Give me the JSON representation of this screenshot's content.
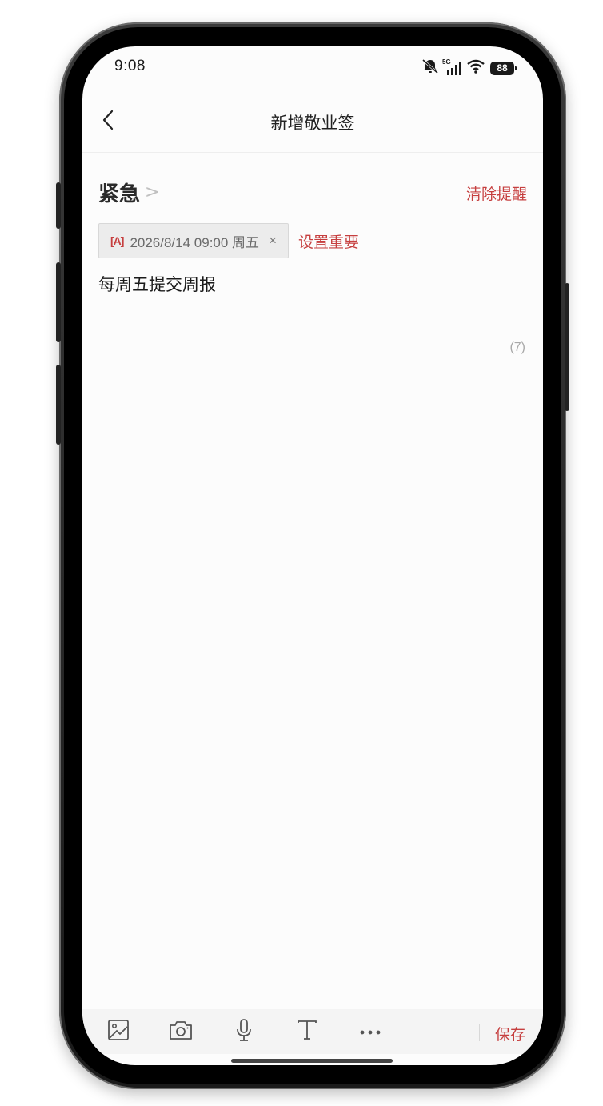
{
  "status_bar": {
    "time": "9:08",
    "battery": "88",
    "network": "5G"
  },
  "nav": {
    "title": "新增敬业签",
    "back_icon": "chevron-left-icon"
  },
  "priority": {
    "label": "紧急",
    "chevron": ">",
    "clear_reminder_label": "清除提醒"
  },
  "reminder": {
    "icon_text": "[A]",
    "datetime": "2026/8/14 09:00 周五",
    "close_glyph": "×",
    "set_important_label": "设置重要"
  },
  "note": {
    "content": "每周五提交周报",
    "char_count": "(7)"
  },
  "toolbar": {
    "save_label": "保存"
  },
  "colors": {
    "accent": "#c63f3f",
    "background": "#fcfcfc",
    "chip_bg": "#ececec",
    "toolbar_bg": "#f4f4f4"
  }
}
